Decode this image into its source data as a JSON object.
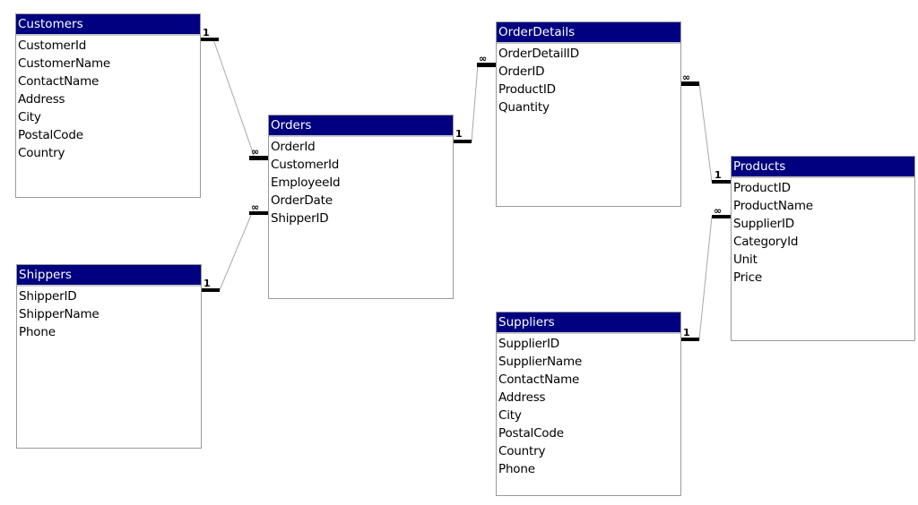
{
  "diagram": {
    "type": "entity-relationship",
    "colors": {
      "header_bg": "#000080",
      "header_text": "#ffffff",
      "border": "#9a9a9a",
      "link_line": "#a0a0a0"
    },
    "tables": {
      "customers": {
        "title": "Customers",
        "fields": [
          "CustomerId",
          "CustomerName",
          "ContactName",
          "Address",
          "City",
          "PostalCode",
          "Country"
        ]
      },
      "orders": {
        "title": "Orders",
        "fields": [
          "OrderId",
          "CustomerId",
          "EmployeeId",
          "OrderDate",
          "ShipperID"
        ]
      },
      "orderdetails": {
        "title": "OrderDetails",
        "fields": [
          "OrderDetailID",
          "OrderID",
          "ProductID",
          "Quantity"
        ]
      },
      "shippers": {
        "title": "Shippers",
        "fields": [
          "ShipperID",
          "ShipperName",
          "Phone"
        ]
      },
      "products": {
        "title": "Products",
        "fields": [
          "ProductID",
          "ProductName",
          "SupplierID",
          "CategoryId",
          "Unit",
          "Price"
        ]
      },
      "suppliers": {
        "title": "Suppliers",
        "fields": [
          "SupplierID",
          "SupplierName",
          "ContactName",
          "Address",
          "City",
          "PostalCode",
          "Country",
          "Phone"
        ]
      }
    },
    "relationships": [
      {
        "from": "Customers",
        "from_field": "CustomerId",
        "from_cardinality": "1",
        "to": "Orders",
        "to_field": "CustomerId",
        "to_cardinality": "∞"
      },
      {
        "from": "Shippers",
        "from_field": "ShipperID",
        "from_cardinality": "1",
        "to": "Orders",
        "to_field": "ShipperID",
        "to_cardinality": "∞"
      },
      {
        "from": "Orders",
        "from_field": "OrderId",
        "from_cardinality": "1",
        "to": "OrderDetails",
        "to_field": "OrderID",
        "to_cardinality": "∞"
      },
      {
        "from": "Products",
        "from_field": "ProductID",
        "from_cardinality": "1",
        "to": "OrderDetails",
        "to_field": "ProductID",
        "to_cardinality": "∞"
      },
      {
        "from": "Suppliers",
        "from_field": "SupplierID",
        "from_cardinality": "1",
        "to": "Products",
        "to_field": "SupplierID",
        "to_cardinality": "∞"
      }
    ]
  }
}
